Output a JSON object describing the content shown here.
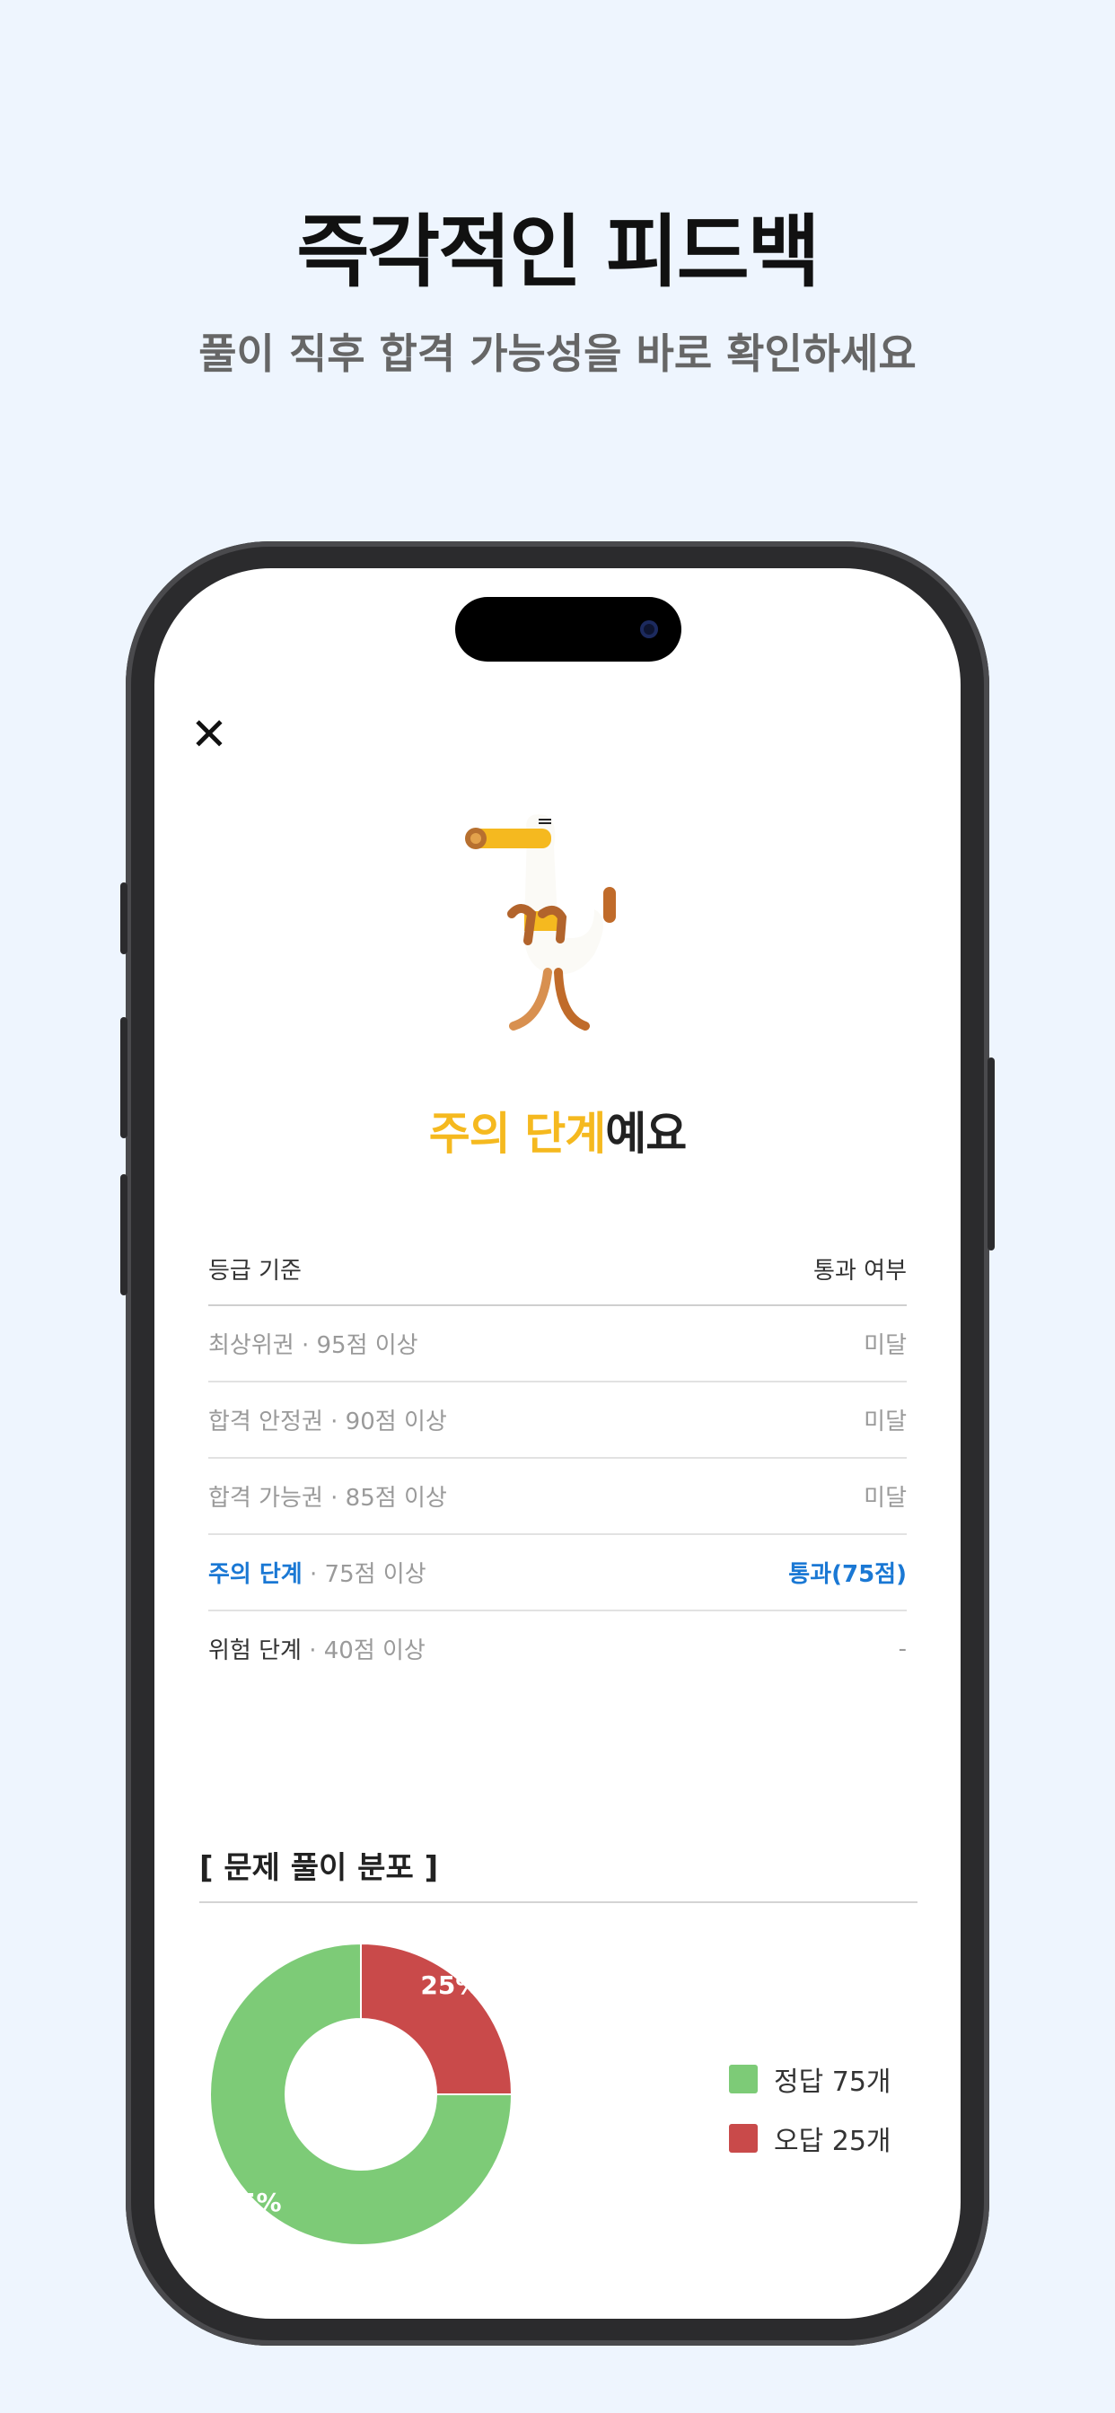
{
  "headline": "즉각적인 피드백",
  "subline": "풀이 직후 합격 가능성을 바로 확인하세요",
  "close_icon": "close-icon",
  "status": {
    "highlight": "주의 단계",
    "rest": "예요",
    "highlight_color": "#f5b91f"
  },
  "grade_table": {
    "header_left": "등급 기준",
    "header_right": "통과 여부",
    "rows": [
      {
        "name": "최상위권",
        "detail": " · 95점 이상",
        "result": "미달"
      },
      {
        "name": "합격 안정권",
        "detail": " · 90점 이상",
        "result": "미달"
      },
      {
        "name": "합격 가능권",
        "detail": " · 85점 이상",
        "result": "미달"
      },
      {
        "name": "주의 단계",
        "detail": " · 75점 이상",
        "result": "통과(75점)"
      },
      {
        "name": "위험 단계",
        "detail": " · 40점 이상",
        "result": "-"
      }
    ]
  },
  "distribution": {
    "title": "[ 문제 풀이 분포 ]",
    "legend": [
      {
        "label": "정답 75개",
        "color": "#7dcb77"
      },
      {
        "label": "오답 25개",
        "color": "#c94a4a"
      }
    ]
  },
  "chart_data": {
    "type": "pie",
    "categories": [
      "정답",
      "오답"
    ],
    "values": [
      75,
      25
    ],
    "labels": [
      "75%",
      "25%"
    ],
    "colors": [
      "#7dcb77",
      "#c94a4a"
    ]
  }
}
